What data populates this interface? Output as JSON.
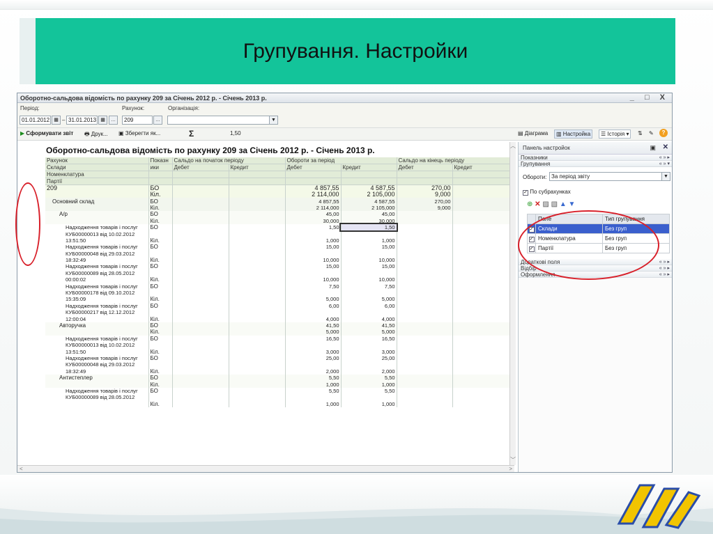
{
  "slide": {
    "title": "Групування. Настройки"
  },
  "window": {
    "title": "Оборотно-сальдова відомість по рахунку 209 за Січень 2012 р. - Січень 2013 р.",
    "controls": "_ □ X"
  },
  "params": {
    "period_label": "Період:",
    "period_from": "01.01.2012",
    "period_dash": "–",
    "period_to": "31.01.2013",
    "account_label": "Рахунок:",
    "account_value": "209",
    "org_label": "Організація:",
    "org_value": ""
  },
  "toolbar": {
    "form_report": "Сформувати звіт",
    "print": "Друк...",
    "save_as": "Зберегти як...",
    "sigma": "Σ",
    "sum_value": "1,50",
    "diagram": "Діаграма",
    "settings": "Настройка",
    "history": "Історія"
  },
  "report": {
    "title": "Оборотно-сальдова відомість по рахунку 209 за Січень 2012 р. - Січень 2013 р.",
    "headers": {
      "account": "Рахунок",
      "indicator_1": "Показн",
      "indicator_2": "ики",
      "balance_start": "Сальдо на початок періоду",
      "turnover": "Обороти за період",
      "balance_end": "Сальдо на кінець періоду",
      "debit": "Дебет",
      "credit": "Кредит",
      "warehouses": "Склади",
      "nomenclature": "Номенклатура",
      "parties": "Партії"
    },
    "rows": [
      {
        "type": "r209",
        "name": "209",
        "ind": "БО",
        "td": "4 857,55",
        "tc": "4 587,55",
        "ed": "270,00"
      },
      {
        "type": "r209",
        "name": "",
        "ind": "Кіл.",
        "td": "2 114,000",
        "tc": "2 105,000",
        "ed": "9,000"
      },
      {
        "type": "rgrp",
        "name": "Основний склад",
        "ind": "БО",
        "td": "4 857,55",
        "tc": "4 587,55",
        "ed": "270,00"
      },
      {
        "type": "rgrp",
        "name": "",
        "ind": "Кіл.",
        "td": "2 114,000",
        "tc": "2 105,000",
        "ed": "9,000"
      },
      {
        "type": "rsub",
        "name": "А/р",
        "ind": "БО",
        "td": "45,00",
        "tc": "45,00",
        "ed": ""
      },
      {
        "type": "rsub",
        "name": "",
        "ind": "Кіл.",
        "td": "30,000",
        "tc": "30,000",
        "ed": ""
      },
      {
        "type": "rdoc",
        "name": "Надходження товарів і послуг",
        "ind": "БО",
        "td": "1,50",
        "tc": "1,50",
        "ed": "",
        "sel": true
      },
      {
        "type": "rdoc",
        "name": "КУБ00000013 від 10.02.2012",
        "ind": "",
        "td": "",
        "tc": "",
        "ed": ""
      },
      {
        "type": "rdoc",
        "name": "13:51:50",
        "ind": "Кіл.",
        "td": "1,000",
        "tc": "1,000",
        "ed": ""
      },
      {
        "type": "rdoc",
        "name": "Надходження товарів і послуг",
        "ind": "БО",
        "td": "15,00",
        "tc": "15,00",
        "ed": ""
      },
      {
        "type": "rdoc",
        "name": "КУБ00000048 від 29.03.2012",
        "ind": "",
        "td": "",
        "tc": "",
        "ed": ""
      },
      {
        "type": "rdoc",
        "name": "18:32:49",
        "ind": "Кіл.",
        "td": "10,000",
        "tc": "10,000",
        "ed": ""
      },
      {
        "type": "rdoc",
        "name": "Надходження товарів і послуг",
        "ind": "БО",
        "td": "15,00",
        "tc": "15,00",
        "ed": ""
      },
      {
        "type": "rdoc",
        "name": "КУБ00000089 від 28.05.2012",
        "ind": "",
        "td": "",
        "tc": "",
        "ed": ""
      },
      {
        "type": "rdoc",
        "name": "00:00:02",
        "ind": "Кіл.",
        "td": "10,000",
        "tc": "10,000",
        "ed": ""
      },
      {
        "type": "rdoc",
        "name": "Надходження товарів і послуг",
        "ind": "БО",
        "td": "7,50",
        "tc": "7,50",
        "ed": ""
      },
      {
        "type": "rdoc",
        "name": "КУБ00000178 від 09.10.2012",
        "ind": "",
        "td": "",
        "tc": "",
        "ed": ""
      },
      {
        "type": "rdoc",
        "name": "15:35:09",
        "ind": "Кіл.",
        "td": "5,000",
        "tc": "5,000",
        "ed": ""
      },
      {
        "type": "rdoc",
        "name": "Надходження товарів і послуг",
        "ind": "БО",
        "td": "6,00",
        "tc": "6,00",
        "ed": ""
      },
      {
        "type": "rdoc",
        "name": "КУБ00000217 від 12.12.2012",
        "ind": "",
        "td": "",
        "tc": "",
        "ed": ""
      },
      {
        "type": "rdoc",
        "name": "12:00:04",
        "ind": "Кіл.",
        "td": "4,000",
        "tc": "4,000",
        "ed": ""
      },
      {
        "type": "rsub",
        "name": "Авторучка",
        "ind": "БО",
        "td": "41,50",
        "tc": "41,50",
        "ed": ""
      },
      {
        "type": "rsub",
        "name": "",
        "ind": "Кіл.",
        "td": "5,000",
        "tc": "5,000",
        "ed": ""
      },
      {
        "type": "rdoc",
        "name": "Надходження товарів і послуг",
        "ind": "БО",
        "td": "16,50",
        "tc": "16,50",
        "ed": ""
      },
      {
        "type": "rdoc",
        "name": "КУБ00000013 від 10.02.2012",
        "ind": "",
        "td": "",
        "tc": "",
        "ed": ""
      },
      {
        "type": "rdoc",
        "name": "13:51:50",
        "ind": "Кіл.",
        "td": "3,000",
        "tc": "3,000",
        "ed": ""
      },
      {
        "type": "rdoc",
        "name": "Надходження товарів і послуг",
        "ind": "БО",
        "td": "25,00",
        "tc": "25,00",
        "ed": ""
      },
      {
        "type": "rdoc",
        "name": "КУБ00000048 від 29.03.2012",
        "ind": "",
        "td": "",
        "tc": "",
        "ed": ""
      },
      {
        "type": "rdoc",
        "name": "18:32:49",
        "ind": "Кіл.",
        "td": "2,000",
        "tc": "2,000",
        "ed": ""
      },
      {
        "type": "rsub",
        "name": "Антистеплер",
        "ind": "БО",
        "td": "5,50",
        "tc": "5,50",
        "ed": ""
      },
      {
        "type": "rsub",
        "name": "",
        "ind": "Кіл.",
        "td": "1,000",
        "tc": "1,000",
        "ed": ""
      },
      {
        "type": "rdoc",
        "name": "Надходження товарів і послуг",
        "ind": "БО",
        "td": "5,50",
        "tc": "5,50",
        "ed": ""
      },
      {
        "type": "rdoc",
        "name": "КУБ00000089 від 28.05.2012",
        "ind": "",
        "td": "",
        "tc": "",
        "ed": ""
      },
      {
        "type": "rdoc",
        "name": "",
        "ind": "Кіл.",
        "td": "1,000",
        "tc": "1,000",
        "ed": ""
      }
    ]
  },
  "panel": {
    "title": "Панель настройок",
    "sections": {
      "indicators": "Показники",
      "grouping": "Групування",
      "additional": "Додаткові поля",
      "selection": "Відбір",
      "formatting": "Оформлення"
    },
    "turnover_label": "Обороти:",
    "turnover_value": "За період звіту",
    "by_subaccounts": "По субрахунках",
    "grid_headers": {
      "field": "Поле",
      "type": "Тип групування"
    },
    "grid_rows": [
      {
        "field": "Склади",
        "type": "Без груп"
      },
      {
        "field": "Номенклатура",
        "type": "Без груп"
      },
      {
        "field": "Партії",
        "type": "Без груп"
      }
    ]
  },
  "colors": {
    "title_bar": "#13c49a",
    "annotation": "#d8202a",
    "selection": "#3a5fcd"
  }
}
